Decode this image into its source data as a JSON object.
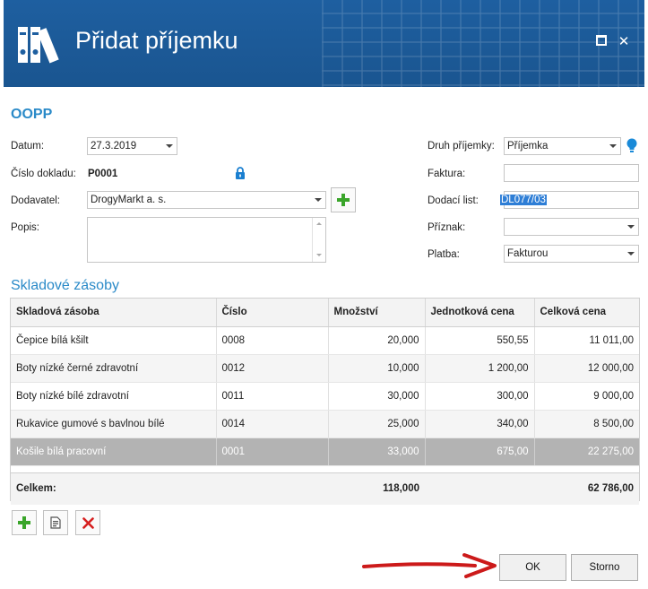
{
  "window": {
    "title": "Přidat příjemku",
    "controls": [
      "maximize-icon",
      "close-icon"
    ],
    "close_glyph": "✕"
  },
  "section": {
    "title": "OOPP"
  },
  "form": {
    "datum": {
      "label": "Datum:",
      "value": "27.3.2019"
    },
    "cislo_dokladu": {
      "label": "Číslo dokladu:",
      "value": "P0001"
    },
    "dodavatel": {
      "label": "Dodavatel:",
      "value": "DrogyMarkt a. s."
    },
    "popis": {
      "label": "Popis:",
      "value": ""
    },
    "druh_prijemky": {
      "label": "Druh příjemky:",
      "value": "Příjemka"
    },
    "faktura": {
      "label": "Faktura:",
      "value": ""
    },
    "dodaci_list": {
      "label": "Dodací list:",
      "value": "DL077/03",
      "visible_value": "DL077/03"
    },
    "priznak": {
      "label": "Příznak:",
      "value": ""
    },
    "platba": {
      "label": "Platba:",
      "value": "Fakturou"
    }
  },
  "stock": {
    "title": "Skladové zásoby",
    "columns": [
      "Skladová zásoba",
      "Číslo",
      "Množství",
      "Jednotková cena",
      "Celková cena"
    ],
    "rows": [
      {
        "name": "Čepice bílá kšilt",
        "number": "0008",
        "qty": "20,000",
        "unit_price": "550,55",
        "total": "11 011,00"
      },
      {
        "name": "Boty nízké černé zdravotní",
        "number": "0012",
        "qty": "10,000",
        "unit_price": "1 200,00",
        "total": "12 000,00"
      },
      {
        "name": "Boty nízké bílé zdravotní",
        "number": "0011",
        "qty": "30,000",
        "unit_price": "300,00",
        "total": "9 000,00"
      },
      {
        "name": "Rukavice gumové s bavlnou bílé",
        "number": "0014",
        "qty": "25,000",
        "unit_price": "340,00",
        "total": "8 500,00"
      },
      {
        "name": "Košile bílá pracovní",
        "number": "0001",
        "qty": "33,000",
        "unit_price": "675,00",
        "total": "22 275,00"
      }
    ],
    "selected_row": 4,
    "summary": {
      "label": "Celkem:",
      "qty": "118,000",
      "total": "62 786,00"
    }
  },
  "buttons": {
    "ok": "OK",
    "cancel": "Storno"
  },
  "colors": {
    "title_bar": "#1e5fa0",
    "accent": "#2a8ac8",
    "add_green": "#3aa52a",
    "delete_red": "#d61f1f",
    "arrow_red": "#cc1a1a"
  }
}
